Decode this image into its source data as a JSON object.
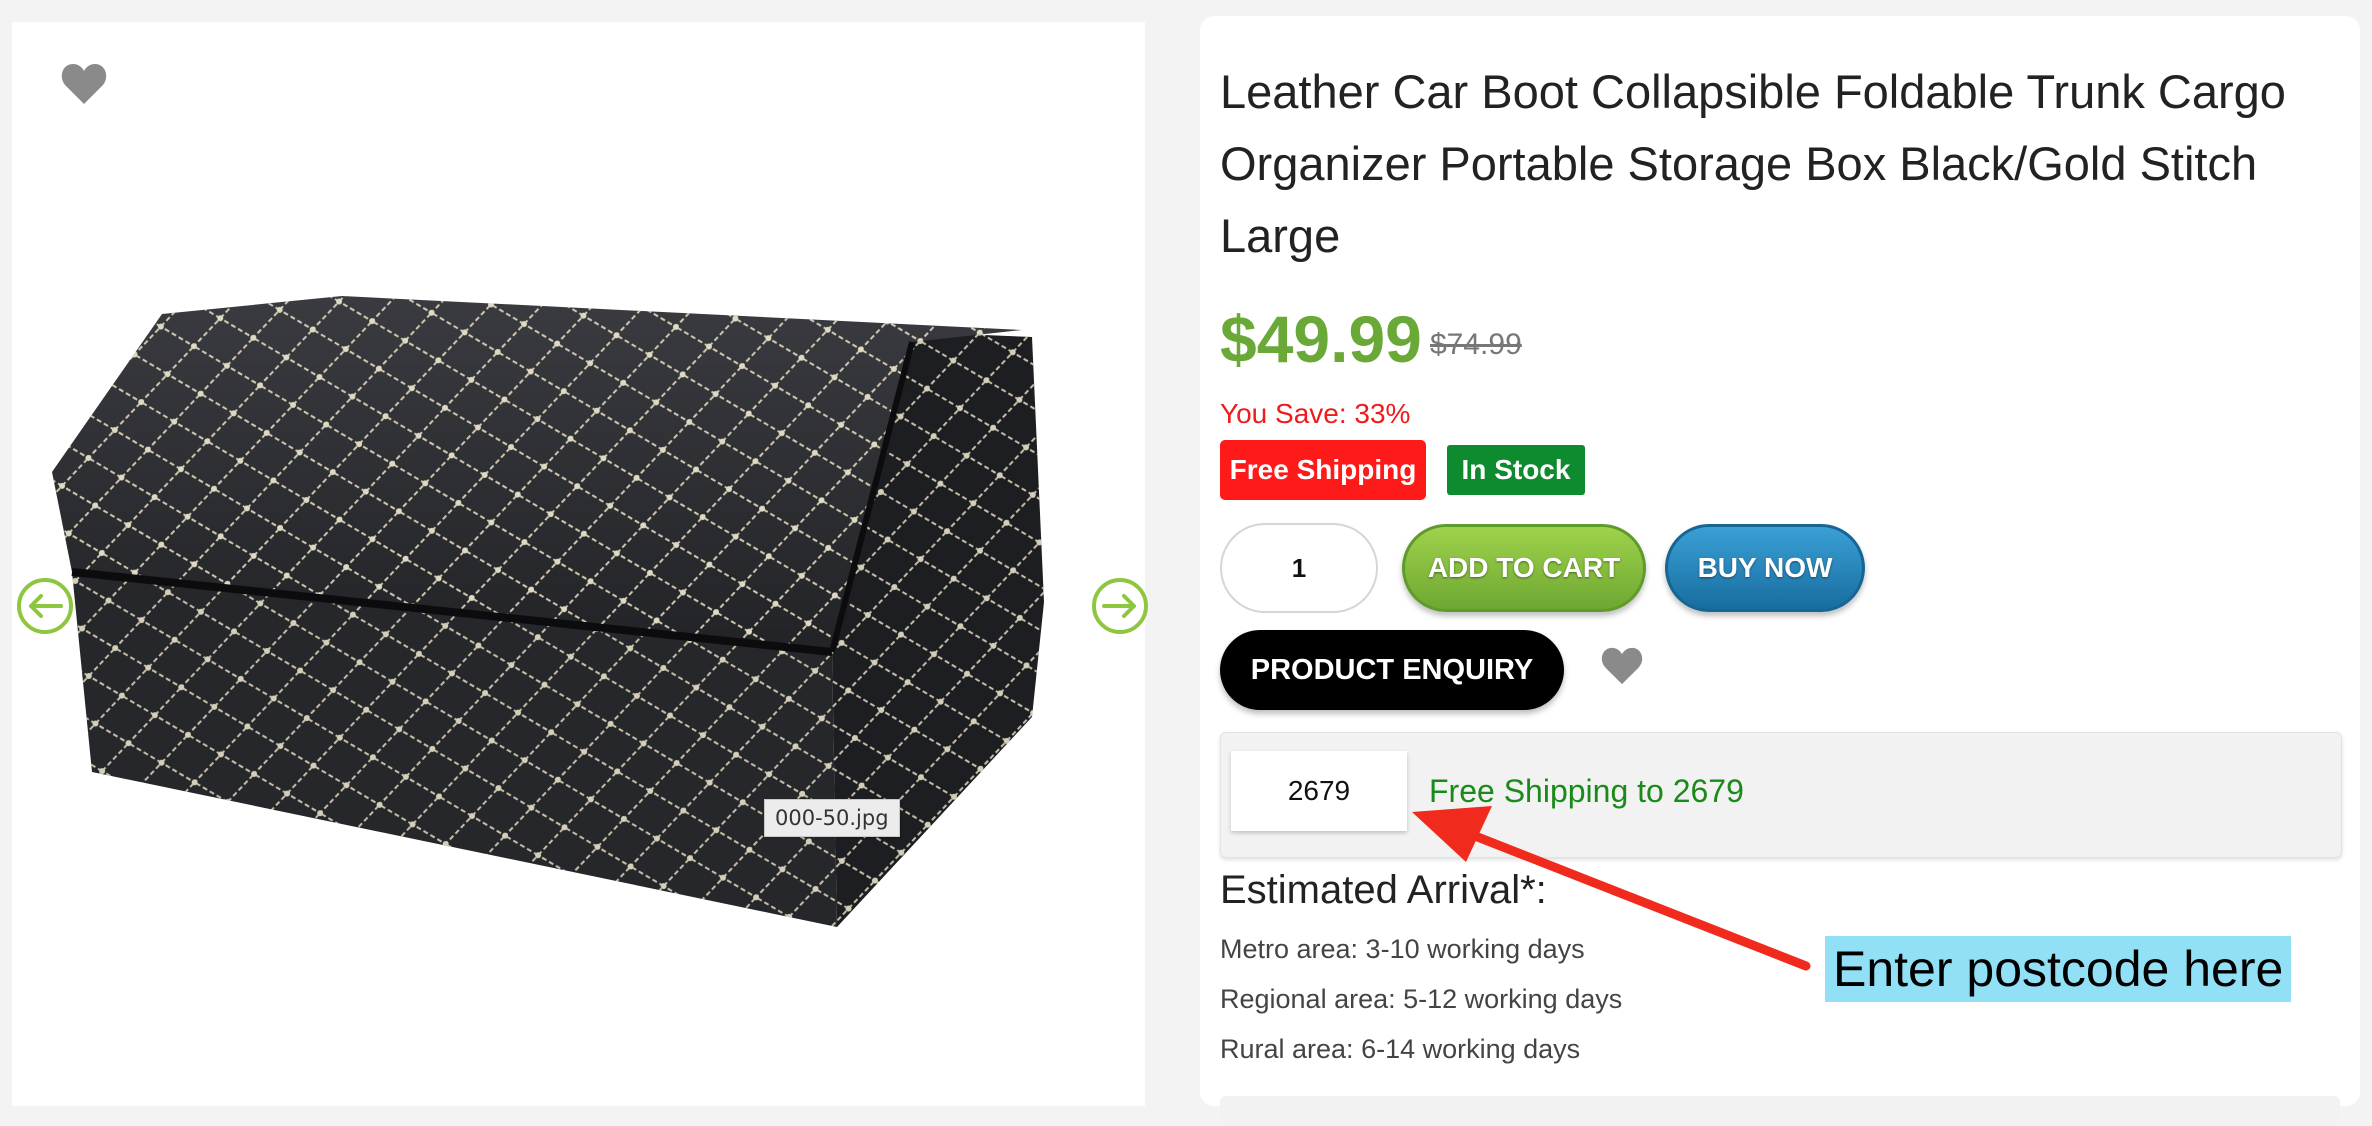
{
  "gallery": {
    "tooltip": "000-50.jpg",
    "icons": {
      "wishlist": "heart-icon",
      "prev": "arrow-left-icon",
      "next": "arrow-right-icon"
    }
  },
  "product": {
    "title": "Leather Car Boot Collapsible Foldable Trunk Cargo Organizer Portable Storage Box Black/Gold Stitch Large",
    "price": "$49.99",
    "old_price": "$74.99",
    "you_save": "You Save: 33%",
    "badges": {
      "shipping": "Free Shipping",
      "stock": "In Stock"
    },
    "quantity": "1",
    "buttons": {
      "add_to_cart": "ADD TO CART",
      "buy_now": "BUY NOW",
      "enquiry": "PRODUCT ENQUIRY"
    }
  },
  "shipping": {
    "postcode": "2679",
    "message": "Free Shipping to 2679"
  },
  "arrival": {
    "title": "Estimated Arrival*:",
    "lines": [
      "Metro area: 3-10 working days",
      "Regional area: 5-12 working days",
      "Rural area: 6-14 working days"
    ]
  },
  "annotation": {
    "callout": "Enter postcode here"
  },
  "colors": {
    "price": "#6aa938",
    "save": "#ee1c1c",
    "shipping_badge": "#ff1a1a",
    "stock_badge": "#0f8b2f",
    "cart_button": "#7cb83a",
    "buy_button": "#1f7fb5",
    "ship_message": "#1a8a1a",
    "callout_bg": "#91e0f5",
    "annotation_arrow": "#f02a1c"
  }
}
